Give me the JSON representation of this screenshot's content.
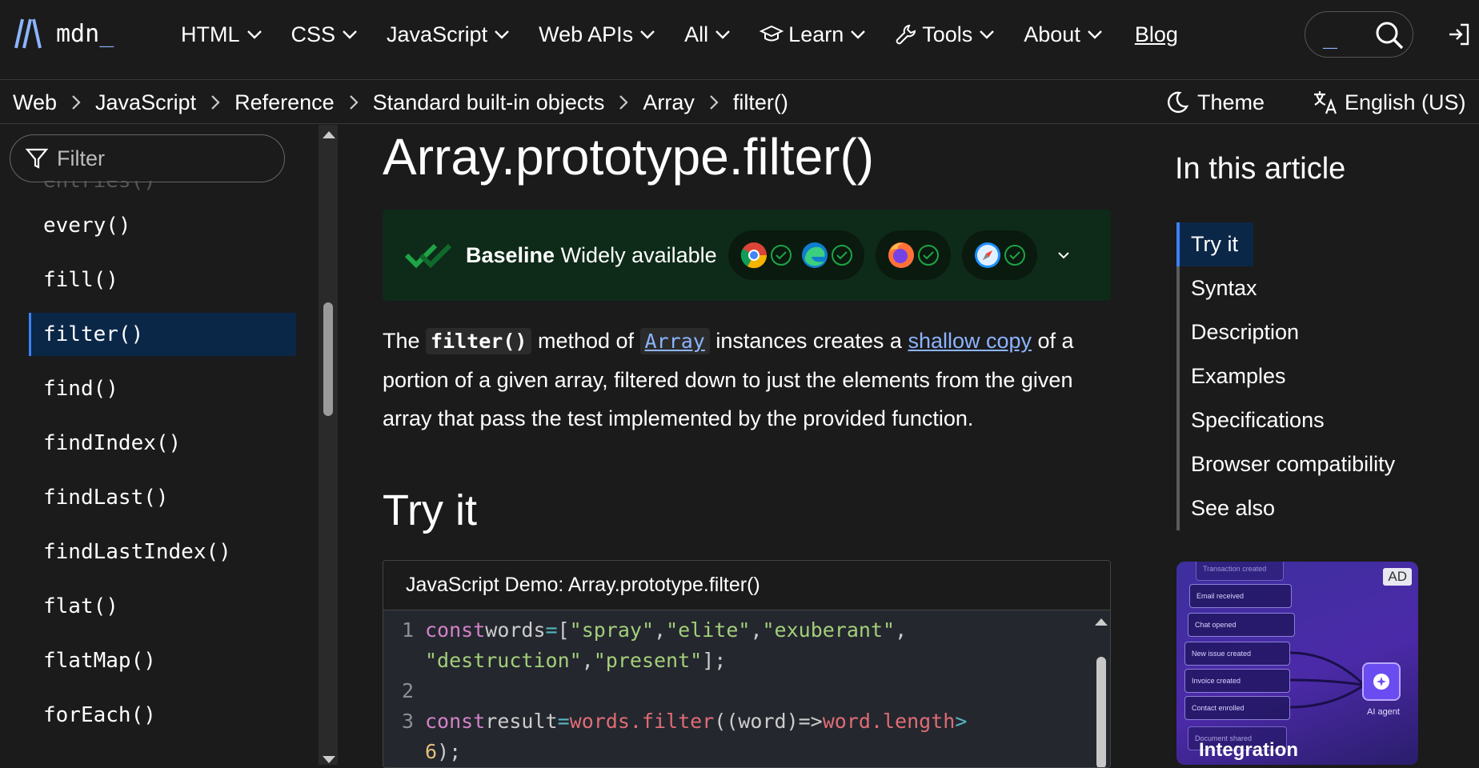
{
  "logo": {
    "text": "mdn",
    "cursor": "_"
  },
  "nav": {
    "items": [
      {
        "label": "HTML"
      },
      {
        "label": "CSS"
      },
      {
        "label": "JavaScript"
      },
      {
        "label": "Web APIs"
      },
      {
        "label": "All"
      },
      {
        "label": "Learn",
        "icon": "graduation-cap-icon"
      },
      {
        "label": "Tools",
        "icon": "wrench-icon"
      },
      {
        "label": "About"
      }
    ],
    "blog": "Blog",
    "search_cursor": "_"
  },
  "breadcrumbs": [
    "Web",
    "JavaScript",
    "Reference",
    "Standard built-in objects",
    "Array",
    "filter()"
  ],
  "theme_label": "Theme",
  "language_label": "English (US)",
  "sidebar": {
    "filter_placeholder": "Filter",
    "cutoff_item": "entries()",
    "items": [
      {
        "label": "every()"
      },
      {
        "label": "fill()"
      },
      {
        "label": "filter()",
        "active": true
      },
      {
        "label": "find()"
      },
      {
        "label": "findIndex()"
      },
      {
        "label": "findLast()"
      },
      {
        "label": "findLastIndex()"
      },
      {
        "label": "flat()"
      },
      {
        "label": "flatMap()"
      },
      {
        "label": "forEach()"
      }
    ]
  },
  "article": {
    "title": "Array.prototype.filter()",
    "baseline": {
      "strong": "Baseline",
      "status": "Widely available"
    },
    "intro": {
      "p1": "The ",
      "code1": "filter()",
      "p2": " method of ",
      "code2": "Array",
      "p3": " instances creates a ",
      "link": "shallow copy",
      "p4": " of a portion of a given array, filtered down to just the elements from the given array that pass the test implemented by the provided function."
    },
    "tryit_heading": "Try it",
    "demo_title": "JavaScript Demo: Array.prototype.filter()",
    "code": {
      "l1_num": "1",
      "l2_num": "2",
      "l3_num": "3",
      "kw_const": "const",
      "words": "words",
      "eq": "=",
      "open": "[",
      "s1": "\"spray\"",
      "s2": "\"elite\"",
      "s3": "\"exuberant\"",
      "s4": "\"destruction\"",
      "s5": "\"present\"",
      "close": "];",
      "comma": ",",
      "result": "result",
      "words_filter": "words.filter",
      "paren_word": "((word)",
      "arrow": "=>",
      "word_length": "word.length",
      "gt": ">",
      "six": "6",
      "end": ");"
    }
  },
  "toc": {
    "title": "In this article",
    "items": [
      {
        "label": "Try it",
        "active": true
      },
      {
        "label": "Syntax"
      },
      {
        "label": "Description"
      },
      {
        "label": "Examples"
      },
      {
        "label": "Specifications"
      },
      {
        "label": "Browser compatibility"
      },
      {
        "label": "See also"
      }
    ]
  },
  "ad": {
    "badge": "AD",
    "rows": [
      "Transaction created",
      "Email received",
      "Chat opened",
      "New issue created",
      "Invoice created",
      "Contact enrolled",
      "Document shared"
    ],
    "agent_label": "AI agent",
    "headline": "Integration"
  },
  "colors": {
    "accent": "#8cb4ff",
    "active_bg": "#0b2748",
    "baseline_bg": "#0e2a18",
    "check": "#1ea446"
  }
}
